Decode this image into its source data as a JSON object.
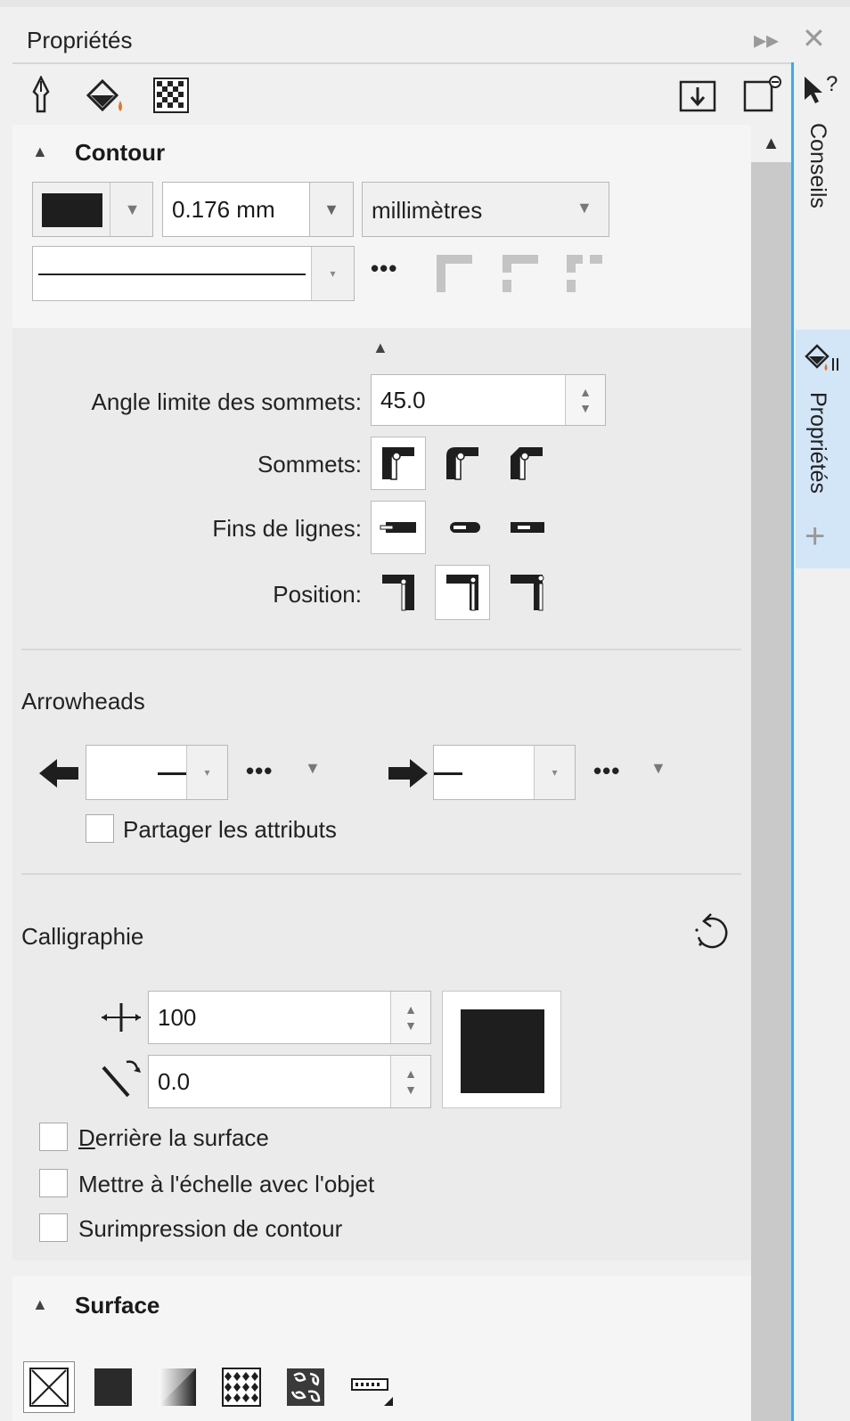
{
  "window": {
    "title": "Propriétés"
  },
  "sidebar": {
    "tabs": [
      "Conseils",
      "Propriétés"
    ],
    "help_label": "?"
  },
  "contour": {
    "header": "Contour",
    "width_value": "0.176 mm",
    "units_value": "millimètres",
    "miter_label": "Angle limite des sommets:",
    "miter_value": "45.0",
    "corners_label": "Sommets:",
    "line_caps_label": "Fins de lignes:",
    "position_label": "Position:"
  },
  "arrowheads": {
    "header": "Arrowheads",
    "share_label": "Partager les attributs"
  },
  "calligraphy": {
    "header": "Calligraphie",
    "stretch_value": "100",
    "angle_value": "0.0",
    "options": [
      "Derrière la surface",
      "Mettre à l'échelle avec l'objet",
      "Surimpression de contour"
    ]
  },
  "surface": {
    "header": "Surface"
  },
  "colors": {
    "accent": "#45a6e6",
    "active_tab": "#d2e6f8",
    "orange": "#e8742a",
    "swatch": "#1e1e1e"
  }
}
